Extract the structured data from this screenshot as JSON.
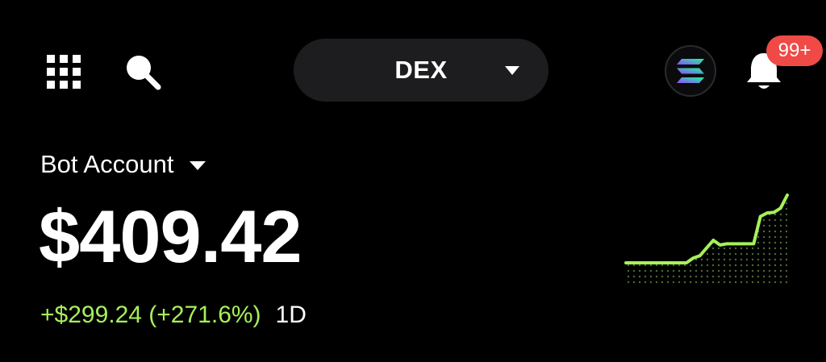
{
  "header": {
    "menu_icon": "grid-icon",
    "search_icon": "search-icon",
    "network_selector": {
      "label": "DEX",
      "icon": "chevron-down-icon"
    },
    "chain_badge": {
      "icon": "solana-icon"
    },
    "notifications": {
      "icon": "bell-icon",
      "badge": "99+"
    }
  },
  "account": {
    "name": "Bot Account",
    "balance": "$409.42",
    "change": "+$299.24 (+271.6%)",
    "period": "1D"
  },
  "colors": {
    "background": "#000000",
    "pill": "#1d1d1f",
    "positive": "#a6f05a",
    "badge": "#ef4a46"
  },
  "chart_data": {
    "type": "line",
    "title": "",
    "xlabel": "",
    "ylabel": "",
    "x": [
      0,
      1,
      2,
      3,
      4,
      5,
      6,
      7,
      8,
      9,
      10,
      11,
      12,
      13,
      14,
      15,
      16,
      17,
      18,
      19,
      20,
      21,
      22,
      23,
      24
    ],
    "series": [
      {
        "values": [
          110,
          110,
          110,
          110,
          110,
          110,
          110,
          110,
          110,
          110,
          118,
          122,
          135,
          148,
          140,
          142,
          142,
          142,
          142,
          142,
          188,
          194,
          195,
          202,
          224
        ]
      }
    ],
    "grid": false,
    "fill": "dotted"
  }
}
